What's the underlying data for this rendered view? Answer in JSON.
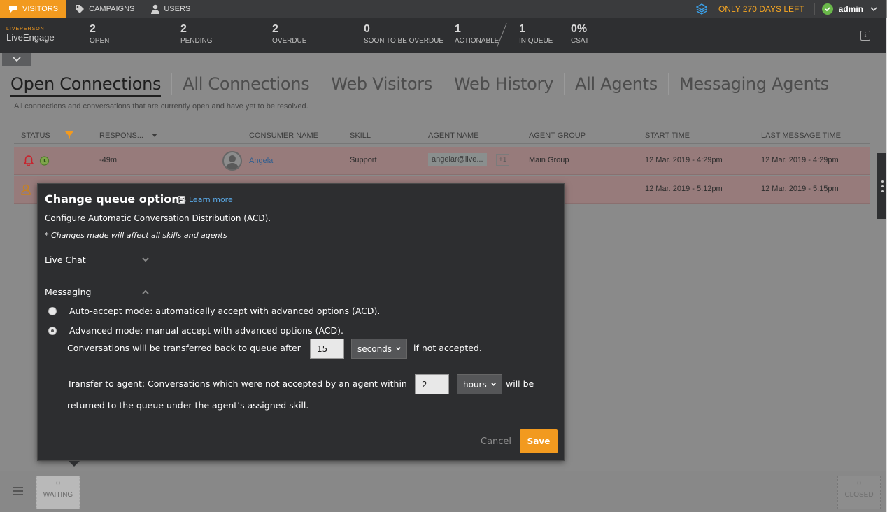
{
  "topnav": {
    "items": [
      {
        "label": "VISITORS",
        "icon": "chat-bubble-icon"
      },
      {
        "label": "CAMPAIGNS",
        "icon": "tag-icon"
      },
      {
        "label": "USERS",
        "icon": "user-icon"
      }
    ],
    "trial": "ONLY 270 DAYS LEFT",
    "user": "admin"
  },
  "brand": {
    "small": "LIVEPERSON",
    "big": "LiveEngage"
  },
  "metrics": [
    {
      "num": "2",
      "label": "OPEN"
    },
    {
      "num": "2",
      "label": "PENDING"
    },
    {
      "num": "2",
      "label": "OVERDUE"
    },
    {
      "num": "0",
      "label": "SOON TO BE OVERDUE"
    },
    {
      "num": "1",
      "label": "ACTIONABLE"
    },
    {
      "num": "1",
      "label": "IN QUEUE"
    },
    {
      "num": "0%",
      "label": "CSAT"
    }
  ],
  "tabs": [
    "Open Connections",
    "All Connections",
    "Web Visitors",
    "Web History",
    "All Agents",
    "Messaging Agents"
  ],
  "subtitle": "All connections and conversations that are currently open and have yet to be resolved.",
  "table": {
    "headers": {
      "status": "STATUS",
      "response": "RESPONS...",
      "consumer": "CONSUMER NAME",
      "skill": "SKILL",
      "agent": "AGENT NAME",
      "group": "AGENT GROUP",
      "start": "START TIME",
      "last": "LAST MESSAGE TIME"
    },
    "rows": [
      {
        "response": "-49m",
        "consumer": "Angela",
        "skill": "Support",
        "agent": "angelar@live...",
        "extra": "+1",
        "group": "Main Group",
        "start": "12 Mar. 2019 - 4:29pm",
        "last": "12 Mar. 2019 - 4:29pm"
      },
      {
        "start": "12 Mar. 2019 - 5:12pm",
        "last": "12 Mar. 2019 - 5:15pm"
      }
    ]
  },
  "modal": {
    "title": "Change queue options",
    "learn_more": "Learn more",
    "desc": "Configure Automatic Conversation Distribution (ACD).",
    "note": "* Changes made will affect all skills and agents",
    "section_chat": "Live Chat",
    "section_messaging": "Messaging",
    "option_auto": "Auto-accept mode: automatically accept with advanced options (ACD).",
    "option_advanced": "Advanced mode: manual accept with advanced options (ACD).",
    "transfer_prefix": "Conversations will be transferred back to queue after",
    "transfer_value": "15",
    "transfer_unit": "seconds",
    "transfer_suffix": "if not accepted.",
    "agent_prefix": "Transfer to agent: Conversations which were not accepted by an agent within",
    "agent_value": "2",
    "agent_unit": "hours",
    "agent_suffix": "will be",
    "agent_line2": "returned to the queue under the agent’s assigned skill.",
    "cancel": "Cancel",
    "save": "Save"
  },
  "bottom": {
    "waiting_count": "0",
    "waiting_label": "WAITING",
    "closed_count": "0",
    "closed_label": "CLOSED"
  },
  "colors": {
    "accent": "#f29a1f",
    "link": "#5aa9e6",
    "ok": "#6ab84a"
  }
}
